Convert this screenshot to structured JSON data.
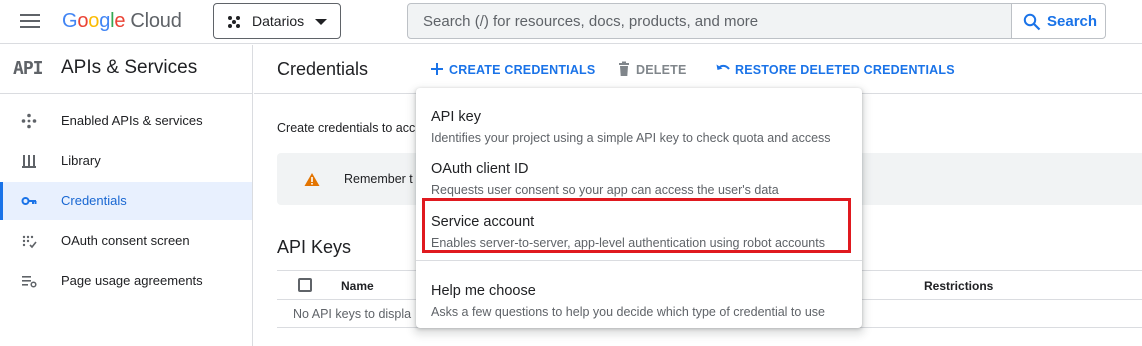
{
  "colors": {
    "accent": "#1a73e8",
    "highlight": "#e0191f",
    "warning": "#e37400"
  },
  "header": {
    "logo_google": "Google",
    "logo_cloud": "Cloud",
    "project": "Datarios",
    "search_placeholder": "Search (/) for resources, docs, products, and more",
    "search_button": "Search"
  },
  "sidebar": {
    "badge": "API",
    "title": "APIs & Services",
    "items": [
      {
        "label": "Enabled APIs & services",
        "icon": "api-dots-icon",
        "active": false
      },
      {
        "label": "Library",
        "icon": "library-icon",
        "active": false
      },
      {
        "label": "Credentials",
        "icon": "key-icon",
        "active": true
      },
      {
        "label": "OAuth consent screen",
        "icon": "consent-icon",
        "active": false
      },
      {
        "label": "Page usage agreements",
        "icon": "agreements-icon",
        "active": false
      }
    ]
  },
  "main": {
    "title": "Credentials",
    "toolbar": {
      "create": "CREATE CREDENTIALS",
      "delete": "DELETE",
      "restore": "RESTORE DELETED CREDENTIALS"
    },
    "intro": "Create credentials to acc",
    "warning": "Remember t",
    "section": "API Keys",
    "table": {
      "headers": [
        "Name",
        "Restrictions"
      ],
      "empty": "No API keys to displa"
    }
  },
  "menu": {
    "items": [
      {
        "title": "API key",
        "desc": "Identifies your project using a simple API key to check quota and access"
      },
      {
        "title": "OAuth client ID",
        "desc": "Requests user consent so your app can access the user's data"
      },
      {
        "title": "Service account",
        "desc": "Enables server-to-server, app-level authentication using robot accounts"
      },
      {
        "title": "Help me choose",
        "desc": "Asks a few questions to help you decide which type of credential to use"
      }
    ]
  }
}
